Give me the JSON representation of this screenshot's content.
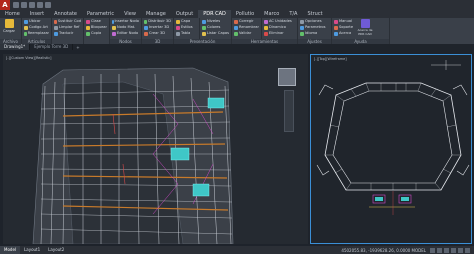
{
  "app": {
    "name_short": "A",
    "window_title": ""
  },
  "ribbon_tabs": [
    "Home",
    "Insert",
    "Annotate",
    "Parametric",
    "View",
    "Manage",
    "Output",
    "PDR CAD",
    "Pollutio",
    "Marco",
    "T/A",
    "Struct"
  ],
  "ribbon": {
    "panels": [
      {
        "title": "Archivo",
        "big": "Cargar",
        "rows": []
      },
      {
        "title": "Articulos",
        "rows": [
          "Ubicar",
          "Codigo Art",
          "Reemplazar"
        ]
      },
      {
        "title": "",
        "rows": [
          "Sustituir Cod",
          "Limpiar Ref",
          "Traducir"
        ]
      },
      {
        "title": "",
        "rows": [
          "Clase",
          "Bloquear",
          "Copia"
        ]
      },
      {
        "title": "Nodos",
        "rows": [
          "Insertar Nodo",
          "Nodo Mat.",
          "Editar Nodo"
        ]
      },
      {
        "title": "3D",
        "rows": [
          "Distribuir 3D",
          "Insertar 3D",
          "Crear 3D"
        ]
      },
      {
        "title": "Presentación",
        "rows": [
          "Capa",
          "Estilos",
          "Tabla"
        ]
      },
      {
        "title": "",
        "rows": [
          "Niveles",
          "Colores",
          "Listar Capas"
        ]
      },
      {
        "title": "Herramientas",
        "rows": [
          "Corregir",
          "Renombrar",
          "Validar"
        ]
      },
      {
        "title": "",
        "rows": [
          "AC Unidades",
          "Dinamico",
          "Eliminar"
        ]
      },
      {
        "title": "Ajustes",
        "rows": [
          "Opciones",
          "Parametros",
          "Idioma"
        ]
      },
      {
        "title": "Ayuda",
        "rows": [
          "Manual",
          "Soporte",
          "Acerca"
        ],
        "big": "Acerca de PDR CAD"
      }
    ]
  },
  "drawing_tabs": [
    "Drawing1*",
    "Ejemplo Torre 3D"
  ],
  "left_viewport": {
    "label": "[-][Custom View][Realistic]"
  },
  "right_viewport": {
    "label": "[-][Top][Wireframe]"
  },
  "status": {
    "layouts": [
      "Model",
      "Layout1",
      "Layout2"
    ],
    "coords": "4502055.83, -1939628.26, 0.0000   MODEL"
  }
}
